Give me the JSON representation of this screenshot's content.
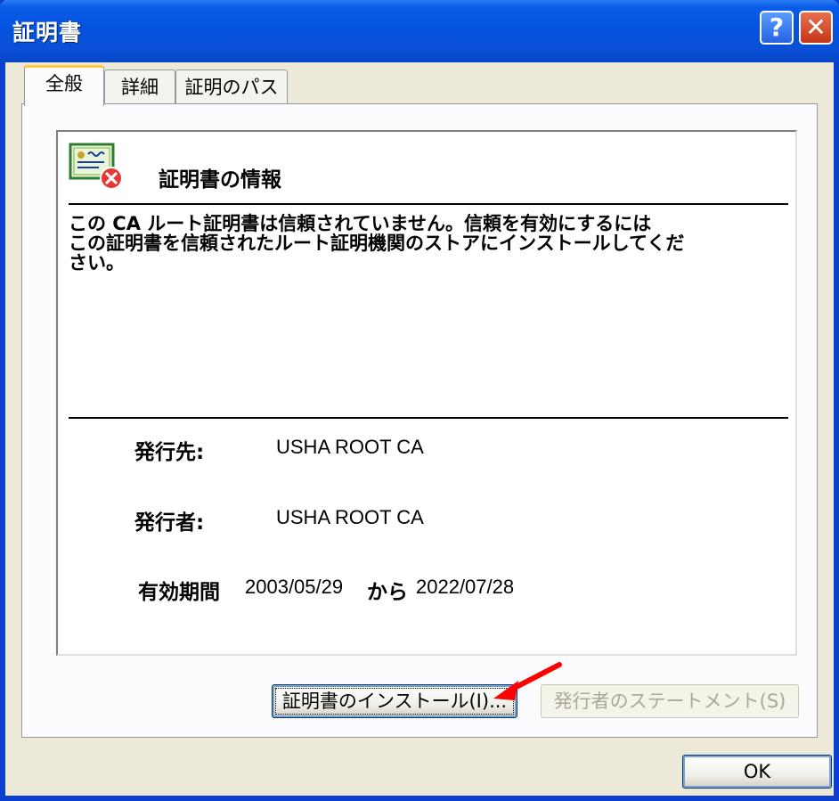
{
  "window": {
    "title": "証明書",
    "help_label": "?",
    "close_label": "✕"
  },
  "tabs": [
    {
      "label": "全般",
      "active": true
    },
    {
      "label": "詳細",
      "active": false
    },
    {
      "label": "証明のパス",
      "active": false
    }
  ],
  "certificate": {
    "icon": "certificate-error-icon",
    "heading": "証明書の情報",
    "message_lines": [
      "この CA ルート証明書は信頼されていません。信頼を有効にするには",
      "この証明書を信頼されたルート証明機関のストアにインストールしてくだ",
      "さい。"
    ],
    "issued_to_label": "発行先:",
    "issued_to_value": "USHA ROOT CA",
    "issued_by_label": "発行者:",
    "issued_by_value": "USHA ROOT CA",
    "validity_label": "有効期間",
    "valid_from": "2003/05/29",
    "valid_sep": "から",
    "valid_to": "2022/07/28"
  },
  "buttons": {
    "install": "証明書のインストール(I)...",
    "statement": "発行者のステートメント(S)",
    "ok": "OK"
  },
  "colors": {
    "titlebar": "#0453e0",
    "face": "#ece9d8",
    "arrow": "#ff0000",
    "active_tab_accent": "#ffc83c"
  }
}
